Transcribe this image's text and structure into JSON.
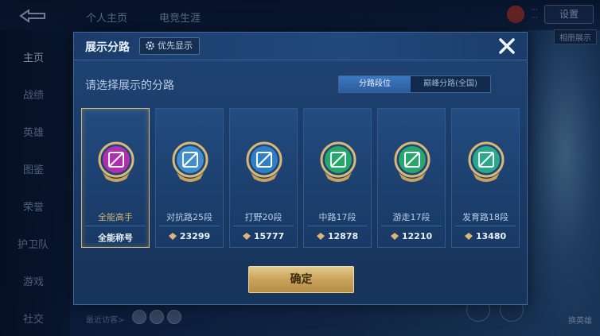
{
  "background": {
    "top_tabs": [
      "个人主页",
      "电竞生涯"
    ],
    "settings_label": "设置",
    "status_lines": [
      "···",
      "···"
    ],
    "sidebar_items": [
      "主页",
      "战绩",
      "英雄",
      "图鉴",
      "荣誉",
      "护卫队",
      "游戏",
      "社交"
    ],
    "active_sidebar": "主页",
    "chip_label": "相册展示",
    "recent_label": "最近访客>",
    "hero_label": "换英雄"
  },
  "modal": {
    "title": "展示分路",
    "priority_label": "优先显示",
    "subtitle": "请选择展示的分路",
    "segments": [
      {
        "label": "分路段位",
        "active": true
      },
      {
        "label": "巅峰分路(全国)",
        "active": false
      }
    ],
    "cards": [
      {
        "name": "全能高手",
        "score": "全能称号",
        "selected": true,
        "color": "#b02fb0",
        "has_score_icon": false
      },
      {
        "name": "对抗路25段",
        "score": "23299",
        "selected": false,
        "color": "#3f8fd0",
        "has_score_icon": true
      },
      {
        "name": "打野20段",
        "score": "15777",
        "selected": false,
        "color": "#2f7fc8",
        "has_score_icon": true
      },
      {
        "name": "中路17段",
        "score": "12878",
        "selected": false,
        "color": "#23a86a",
        "has_score_icon": true
      },
      {
        "name": "游走17段",
        "score": "12210",
        "selected": false,
        "color": "#28a670",
        "has_score_icon": true
      },
      {
        "name": "发育路18段",
        "score": "13480",
        "selected": false,
        "color": "#2aa88a",
        "has_score_icon": true
      }
    ],
    "confirm_label": "确定"
  },
  "colors": {
    "accent_gold": "#d9b876",
    "segment_active": "#3e78c2"
  }
}
